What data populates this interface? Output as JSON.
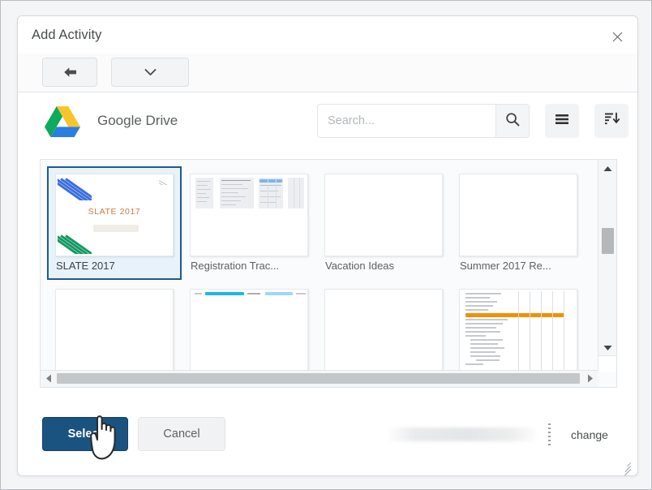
{
  "dialog": {
    "title": "Add Activity",
    "close_icon": "close-icon"
  },
  "nav_toolbar": {
    "back_icon": "arrow-left-icon",
    "dropdown_icon": "chevron-down-icon"
  },
  "provider": {
    "name": "Google Drive",
    "logo_icon": "google-drive-logo-icon"
  },
  "search": {
    "value": "",
    "placeholder": "Search...",
    "button_icon": "search-icon"
  },
  "view_controls": {
    "list_view_icon": "hamburger-list-icon",
    "sort_icon": "sort-descending-icon"
  },
  "files": [
    {
      "name": "SLATE 2017",
      "thumb": "slate-poster",
      "selected": true
    },
    {
      "name": "Registration Trac...",
      "thumb": "spreadsheet",
      "selected": false
    },
    {
      "name": "Vacation Ideas",
      "thumb": "blank",
      "selected": false
    },
    {
      "name": "Summer 2017 Re...",
      "thumb": "blank",
      "selected": false
    },
    {
      "name": "",
      "thumb": "blank",
      "selected": false
    },
    {
      "name": "",
      "thumb": "cyan-header-doc",
      "selected": false
    },
    {
      "name": "",
      "thumb": "blank",
      "selected": false
    },
    {
      "name": "",
      "thumb": "orange-highlight-doc",
      "selected": false
    }
  ],
  "thumb_art": {
    "slate_title": "SLATE 2017"
  },
  "scrollbars": {
    "vertical": {
      "up_icon": "triangle-up-icon",
      "down_icon": "triangle-down-icon"
    },
    "horizontal": {
      "left_icon": "triangle-left-icon",
      "right_icon": "triangle-right-icon"
    }
  },
  "footer": {
    "select_label": "Select",
    "cancel_label": "Cancel",
    "account_label": "",
    "change_label": "change",
    "resize_icon": "resize-grip-icon"
  },
  "cursor": {
    "type": "pointing-hand-cursor"
  },
  "colors": {
    "primary_button": "#1a5380",
    "selection_border": "#1f5a8c",
    "selection_fill": "#e8f2fa",
    "drive_green": "#0da95d",
    "drive_yellow": "#f7c52b",
    "drive_blue": "#2a7de1",
    "slate_accent": "#d2763f",
    "highlight_orange": "#f29100"
  }
}
